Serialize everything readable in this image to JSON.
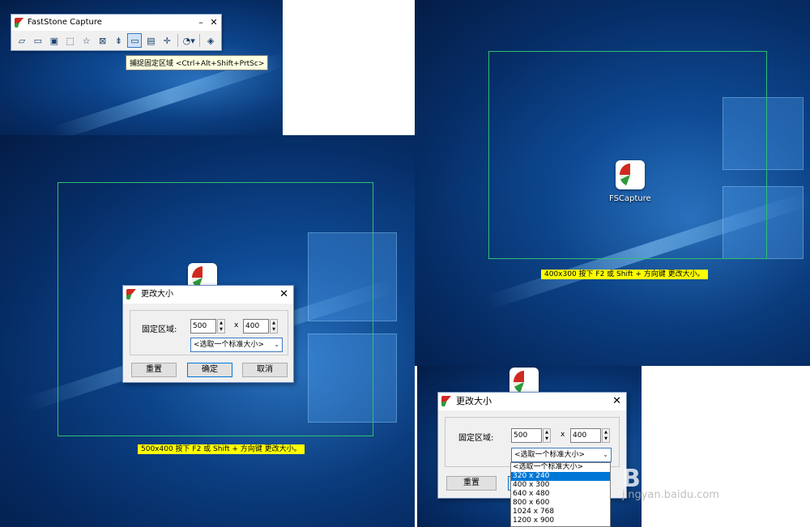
{
  "toolbar_window": {
    "title": "FastStone Capture",
    "minimize": "–",
    "close": "✕",
    "tools": [
      "open",
      "window",
      "object",
      "rectangle",
      "freehand",
      "fullscreen",
      "scrolling",
      "fixed-region",
      "video",
      "crosshair",
      "palette",
      "settings"
    ],
    "tooltip": "捕捉固定区域 <Ctrl+Alt+Shift+PrtSc>"
  },
  "desktop_icon": {
    "label": "FSCapture"
  },
  "hints": {
    "hint_500": "500x400    按下 F2 或 Shift + 方向键 更改大小。",
    "hint_400": "400x300    按下 F2 或 Shift + 方向键 更改大小。"
  },
  "dialog_small": {
    "title": "更改大小",
    "close": "✕",
    "fixed_label": "固定区域:",
    "width": "500",
    "times": "x",
    "height": "400",
    "preset": "<选取一个标准大小>",
    "reset": "重置",
    "ok": "确定",
    "cancel": "取消"
  },
  "dialog_large": {
    "title": "更改大小",
    "close": "✕",
    "fixed_label": "固定区域:",
    "width": "500",
    "times": "x",
    "height": "400",
    "preset": "<选取一个标准大小>",
    "reset": "重置"
  },
  "dropdown_options": [
    "<选取一个标准大小>",
    "320 x 240",
    "400 x 300",
    "640 x 480",
    "800 x 600",
    "1024 x 768",
    "1200 x 900"
  ],
  "dropdown_selected": "320 x 240",
  "watermark": {
    "brand": "Baidu经验",
    "url": "jingyan.baidu.com"
  }
}
